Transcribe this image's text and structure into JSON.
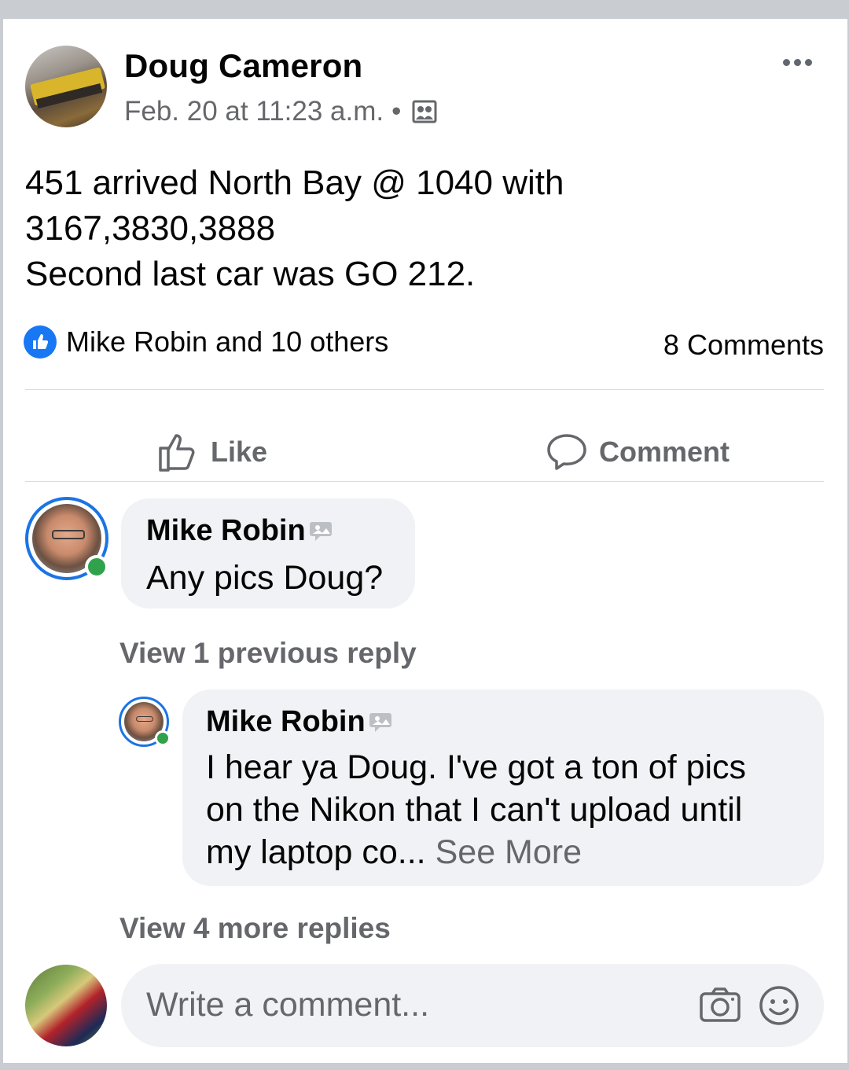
{
  "post": {
    "author": "Doug Cameron",
    "timestamp": "Feb. 20 at 11:23 a.m.",
    "separator": "•",
    "audience_icon": "group-icon",
    "text_lines": [
      "451 arrived North Bay @ 1040 with",
      "3167,3830,3888",
      "Second last car was GO 212."
    ],
    "reactions_text": "Mike Robin and 10 others",
    "comments_count": "8 Comments"
  },
  "actions": {
    "like_label": "Like",
    "comment_label": "Comment"
  },
  "comments": [
    {
      "author": "Mike Robin",
      "text": "Any pics Doug?"
    }
  ],
  "view_previous": "View 1 previous reply",
  "reply": {
    "author": "Mike Robin",
    "text_lines": [
      "I hear ya Doug. I've got a ton of pics",
      "on the Nikon that I can't upload until",
      "my laptop co..."
    ],
    "see_more": "See More"
  },
  "view_more": "View 4 more replies",
  "composer": {
    "placeholder": "Write a comment..."
  },
  "colors": {
    "accent": "#1877f2",
    "online": "#31a24c",
    "muted": "#65676b",
    "bubble": "#f0f2f5"
  }
}
